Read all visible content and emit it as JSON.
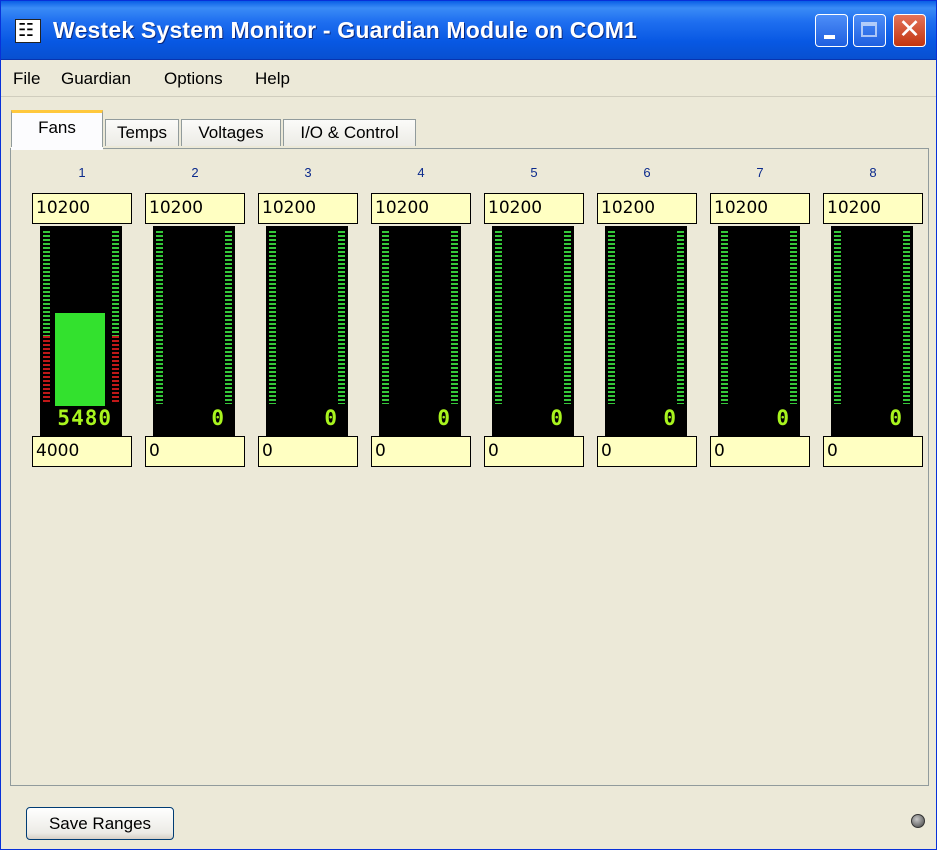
{
  "window": {
    "title": "Westek System Monitor - Guardian Module on COM1"
  },
  "menu": [
    "File",
    "Guardian",
    "Options",
    "Help"
  ],
  "tabs": [
    {
      "label": "Fans",
      "active": true
    },
    {
      "label": "Temps",
      "active": false
    },
    {
      "label": "Voltages",
      "active": false
    },
    {
      "label": "I/O & Control",
      "active": false
    }
  ],
  "fans": [
    {
      "number": "1",
      "max": "10200",
      "min": "4000",
      "reading": "5480",
      "level": 0.537
    },
    {
      "number": "2",
      "max": "10200",
      "min": "0",
      "reading": "0",
      "level": 0
    },
    {
      "number": "3",
      "max": "10200",
      "min": "0",
      "reading": "0",
      "level": 0
    },
    {
      "number": "4",
      "max": "10200",
      "min": "0",
      "reading": "0",
      "level": 0
    },
    {
      "number": "5",
      "max": "10200",
      "min": "0",
      "reading": "0",
      "level": 0
    },
    {
      "number": "6",
      "max": "10200",
      "min": "0",
      "reading": "0",
      "level": 0
    },
    {
      "number": "7",
      "max": "10200",
      "min": "0",
      "reading": "0",
      "level": 0
    },
    {
      "number": "8",
      "max": "10200",
      "min": "0",
      "reading": "0",
      "level": 0
    }
  ],
  "footer": {
    "save_label": "Save Ranges"
  },
  "colors": {
    "bar": "#33e12e",
    "scale_ok": "#35c83a",
    "scale_alarm": "#c01818",
    "readout": "#a8f41e",
    "box_bg": "#ffffc2"
  },
  "icons": {
    "app": "westek-app-icon",
    "status": "status-led-icon",
    "minimize": "minimize-icon",
    "maximize": "maximize-icon",
    "close": "close-icon"
  }
}
